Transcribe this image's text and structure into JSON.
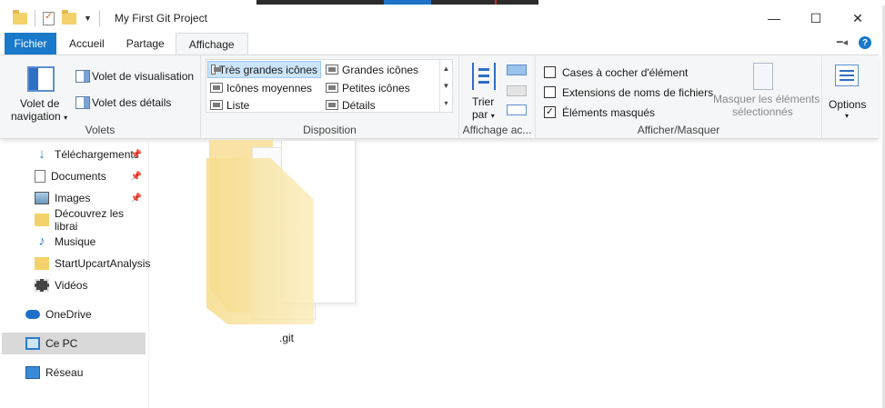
{
  "window": {
    "title": "My First Git Project",
    "controls": {
      "minimize": "—",
      "maximize": "☐",
      "close": "✕"
    }
  },
  "tabs": [
    {
      "label": "Fichier",
      "kind": "file"
    },
    {
      "label": "Accueil"
    },
    {
      "label": "Partage"
    },
    {
      "label": "Affichage",
      "active": true
    }
  ],
  "ribbon": {
    "volets": {
      "group_label": "Volets",
      "nav_pane_line1": "Volet de",
      "nav_pane_line2": "navigation",
      "preview_pane": "Volet de visualisation",
      "details_pane": "Volet des détails"
    },
    "disposition": {
      "group_label": "Disposition",
      "items": [
        {
          "label": "Très grandes icônes",
          "selected": true
        },
        {
          "label": "Grandes icônes"
        },
        {
          "label": "Icônes moyennes"
        },
        {
          "label": "Petites icônes"
        },
        {
          "label": "Liste"
        },
        {
          "label": "Détails"
        }
      ]
    },
    "affichage": {
      "group_label": "Affichage ac...",
      "sort_line1": "Trier",
      "sort_line2": "par"
    },
    "afficher_masquer": {
      "group_label": "Afficher/Masquer",
      "checkboxes": [
        {
          "label": "Cases à cocher d'élément",
          "checked": false
        },
        {
          "label": "Extensions de noms de fichiers",
          "checked": false
        },
        {
          "label": "Éléments masqués",
          "checked": true
        }
      ],
      "hide_selected_line1": "Masquer les éléments",
      "hide_selected_line2": "sélectionnés"
    },
    "options": {
      "label": "Options"
    }
  },
  "sidebar": {
    "items": [
      {
        "label": "Téléchargements",
        "icon": "download-icon",
        "pinned": true
      },
      {
        "label": "Documents",
        "icon": "document-icon",
        "pinned": true
      },
      {
        "label": "Images",
        "icon": "image-icon",
        "pinned": true
      },
      {
        "label": "Découvrez les librai",
        "icon": "folder-icon"
      },
      {
        "label": "Musique",
        "icon": "music-icon"
      },
      {
        "label": "StartUpcartAnalysis",
        "icon": "folder-icon"
      },
      {
        "label": "Vidéos",
        "icon": "video-icon"
      },
      {
        "label": "OneDrive",
        "icon": "cloud-icon"
      },
      {
        "label": "Ce PC",
        "icon": "computer-icon",
        "selected": true
      },
      {
        "label": "Réseau",
        "icon": "network-icon"
      }
    ]
  },
  "content": {
    "items": [
      {
        "name": ".git",
        "type": "hidden-folder"
      }
    ]
  },
  "colors": {
    "accent": "#1979ca",
    "selection": "#cce4f7",
    "folder": "#f3d26b"
  }
}
